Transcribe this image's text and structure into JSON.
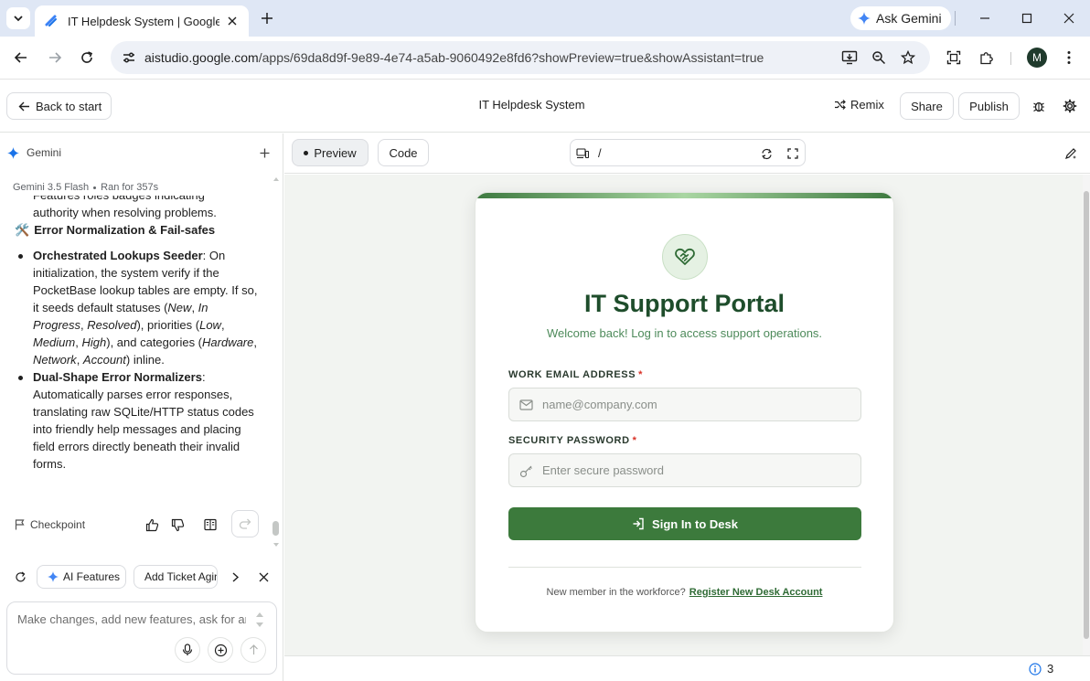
{
  "browser": {
    "tab_title": "IT Helpdesk System | Google AI Studio",
    "ask_gemini": "Ask Gemini",
    "url_host": "aistudio.google.com",
    "url_path": "/apps/69da8d9f-9e89-4e74-a5ab-9060492e8fd6?showPreview=true&showAssistant=true",
    "profile_initial": "M"
  },
  "header": {
    "back_label": "Back to start",
    "title": "IT Helpdesk System",
    "remix": "Remix",
    "share": "Share",
    "publish": "Publish"
  },
  "assistant": {
    "name": "Gemini",
    "model": "Gemini 3.5 Flash",
    "run_time": "Ran for 357s",
    "partial_line_1": "Features roles badges indicating",
    "partial_line_2": "authority when resolving problems.",
    "section_title": "Error Normalization & Fail-safes",
    "bullet1": {
      "bold": "Orchestrated Lookups Seeder",
      "t1": ": On initialization, the system verify if the PocketBase lookup tables are empty. If so, it seeds default statuses (",
      "i1": "New",
      "t2": ", ",
      "i2": "In Progress",
      "t3": ", ",
      "i3": "Resolved",
      "t4": "), priorities (",
      "i4": "Low",
      "t5": ", ",
      "i5": "Medium",
      "t6": ", ",
      "i6": "High",
      "t7": "), and categories (",
      "i7": "Hardware",
      "t8": ", ",
      "i8": "Network",
      "t9": ", ",
      "i9": "Account",
      "t10": ") inline."
    },
    "bullet2": {
      "bold": "Dual-Shape Error Normalizers",
      "text": ": Automatically parses error responses, translating raw SQLite/HTTP status codes into friendly help messages and placing field errors directly beneath their invalid forms."
    },
    "checkpoint": "Checkpoint",
    "chips": [
      "AI Features",
      "Add Ticket Aging"
    ],
    "prompt_placeholder": "Make changes, add new features, ask for anything"
  },
  "preview_bar": {
    "preview_tab": "Preview",
    "code_tab": "Code",
    "path": "/"
  },
  "login": {
    "title": "IT Support Portal",
    "subtitle": "Welcome back! Log in to access support operations.",
    "email_label": "WORK EMAIL ADDRESS",
    "email_placeholder": "name@company.com",
    "password_label": "SECURITY PASSWORD",
    "password_placeholder": "Enter secure password",
    "required_mark": "*",
    "signin": "Sign In to Desk",
    "register_prompt": "New member in the workforce?",
    "register_link": "Register New Desk Account"
  },
  "status": {
    "issues_count": "3"
  },
  "colors": {
    "brand_green": "#3c7a3c",
    "title_green": "#1e4d2b",
    "subtitle_green": "#4d8a5a",
    "required_red": "#d93025"
  }
}
